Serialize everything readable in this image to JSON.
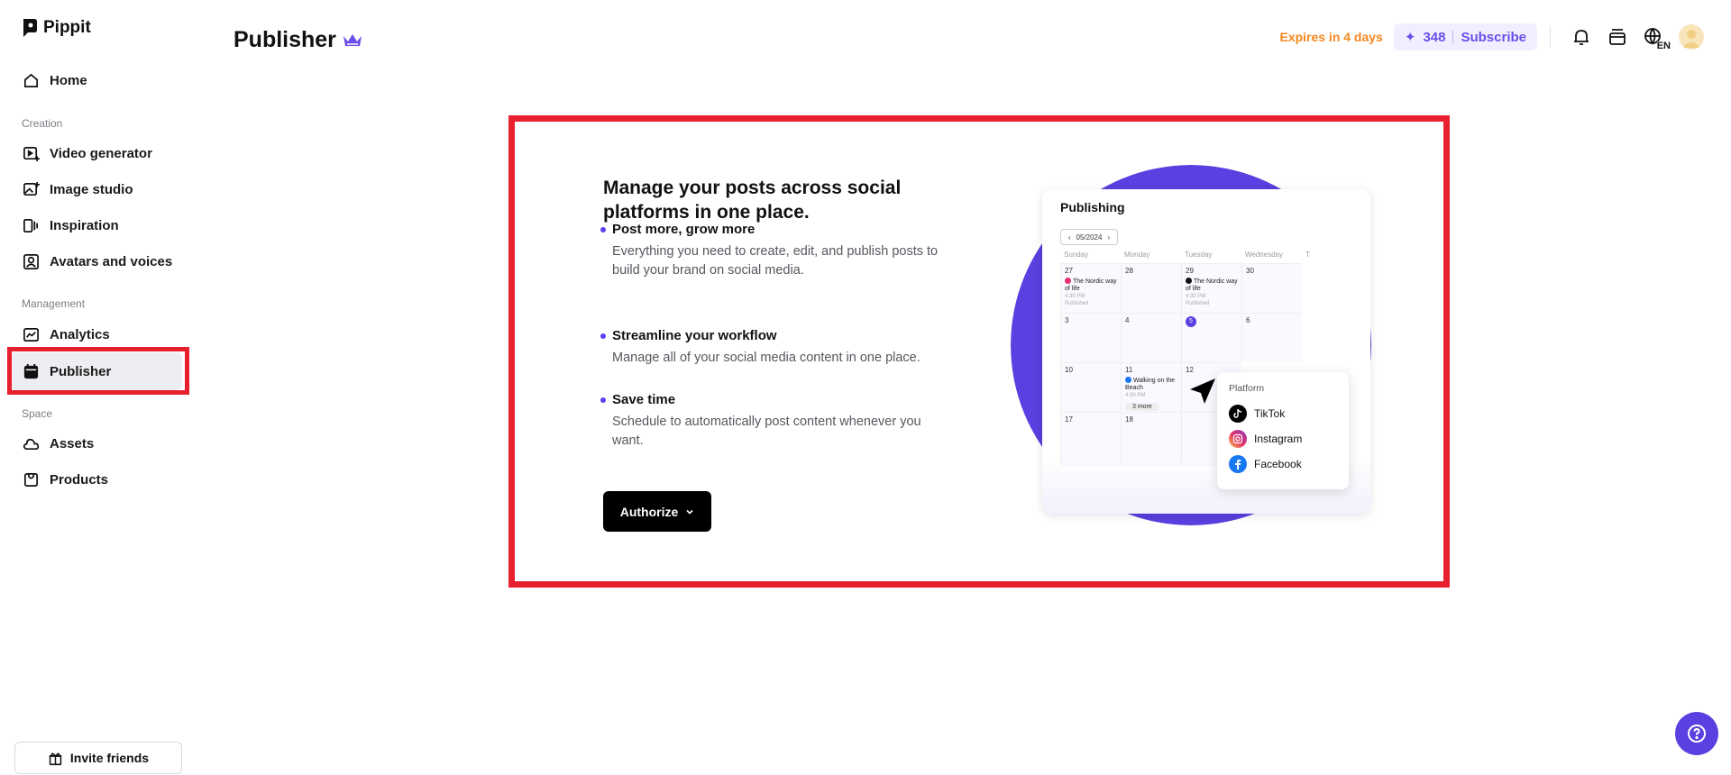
{
  "app": {
    "name": "Pippit"
  },
  "sidebar": {
    "home": "Home",
    "sections": [
      "Creation",
      "Management",
      "Space"
    ],
    "creation_items": [
      "Video generator",
      "Image studio",
      "Inspiration",
      "Avatars and voices"
    ],
    "management_items": [
      "Analytics",
      "Publisher"
    ],
    "space_items": [
      "Assets",
      "Products"
    ],
    "invite": "Invite friends"
  },
  "header": {
    "title": "Publisher",
    "expires": "Expires in 4 days",
    "credits": "348",
    "subscribe": "Subscribe",
    "lang": "EN"
  },
  "main": {
    "headline": "Manage your posts across social platforms in one place.",
    "features": [
      {
        "title": "Post more, grow more",
        "desc": "Everything you need to create, edit, and publish posts to build your brand on social media."
      },
      {
        "title": "Streamline your workflow",
        "desc": "Manage all of your social media content in one place."
      },
      {
        "title": "Save time",
        "desc": "Schedule to automatically post content whenever you want."
      }
    ],
    "authorize": "Authorize"
  },
  "illustration": {
    "title": "Publishing",
    "date": "05/2024",
    "weekdays": [
      "Sunday",
      "Monday",
      "Tuesday",
      "Wednesday",
      "T"
    ],
    "days_row1": [
      "27",
      "28",
      "29",
      "30"
    ],
    "days_row2": [
      "3",
      "4",
      "5",
      "6"
    ],
    "days_row3": [
      "10",
      "11",
      "12"
    ],
    "days_row4": [
      "17",
      "18"
    ],
    "event_nordic": "The Nordic way of life",
    "event_time": "4:30 PM",
    "event_status": "Published",
    "event_beach": "Walking on the Beach",
    "more": "3 more",
    "platform_title": "Platform",
    "platforms": [
      "TikTok",
      "Instagram",
      "Facebook"
    ]
  },
  "colors": {
    "accent": "#5b3fe0",
    "highlight": "#e8202e",
    "expires": "#f5871f"
  }
}
